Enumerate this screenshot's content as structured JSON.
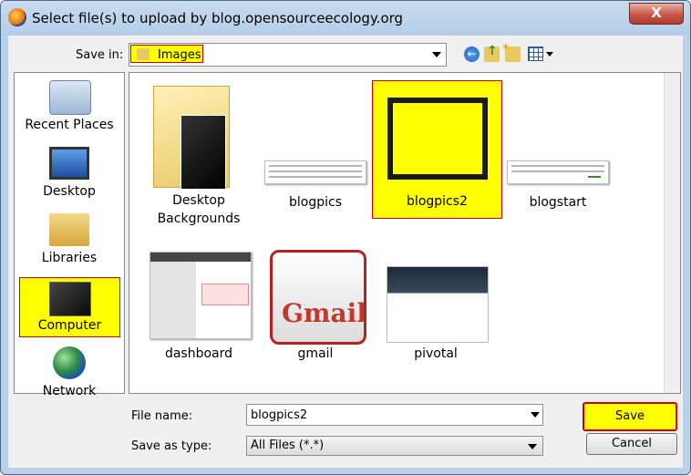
{
  "window": {
    "title": "Select file(s) to upload by blog.opensourceecology.org",
    "close_label": "X"
  },
  "toolbar": {
    "save_in_label": "Save in:",
    "save_in_value": "Images",
    "back_icon": "back-arrow-icon",
    "up_icon": "up-folder-icon",
    "new_folder_icon": "new-folder-icon",
    "views_icon": "views-menu-icon"
  },
  "places": [
    {
      "label": "Recent Places",
      "icon": "recent-places-icon"
    },
    {
      "label": "Desktop",
      "icon": "desktop-icon"
    },
    {
      "label": "Libraries",
      "icon": "libraries-icon"
    },
    {
      "label": "Computer",
      "icon": "computer-icon",
      "selected": true
    },
    {
      "label": "Network",
      "icon": "network-icon"
    }
  ],
  "files": [
    {
      "label": "Desktop Backgrounds",
      "type": "folder"
    },
    {
      "label": "blogpics",
      "type": "image"
    },
    {
      "label": "blogpics2",
      "type": "image",
      "selected": true
    },
    {
      "label": "blogstart",
      "type": "image"
    },
    {
      "label": "dashboard",
      "type": "image"
    },
    {
      "label": "gmail",
      "type": "image"
    },
    {
      "label": "pivotal",
      "type": "image"
    }
  ],
  "gmail_thumb_text": "Gmail",
  "form": {
    "file_name_label": "File name:",
    "file_name_value": "blogpics2",
    "save_as_type_label": "Save as type:",
    "save_as_type_value": "All Files (*.*)",
    "save_button": "Save",
    "cancel_button": "Cancel"
  }
}
